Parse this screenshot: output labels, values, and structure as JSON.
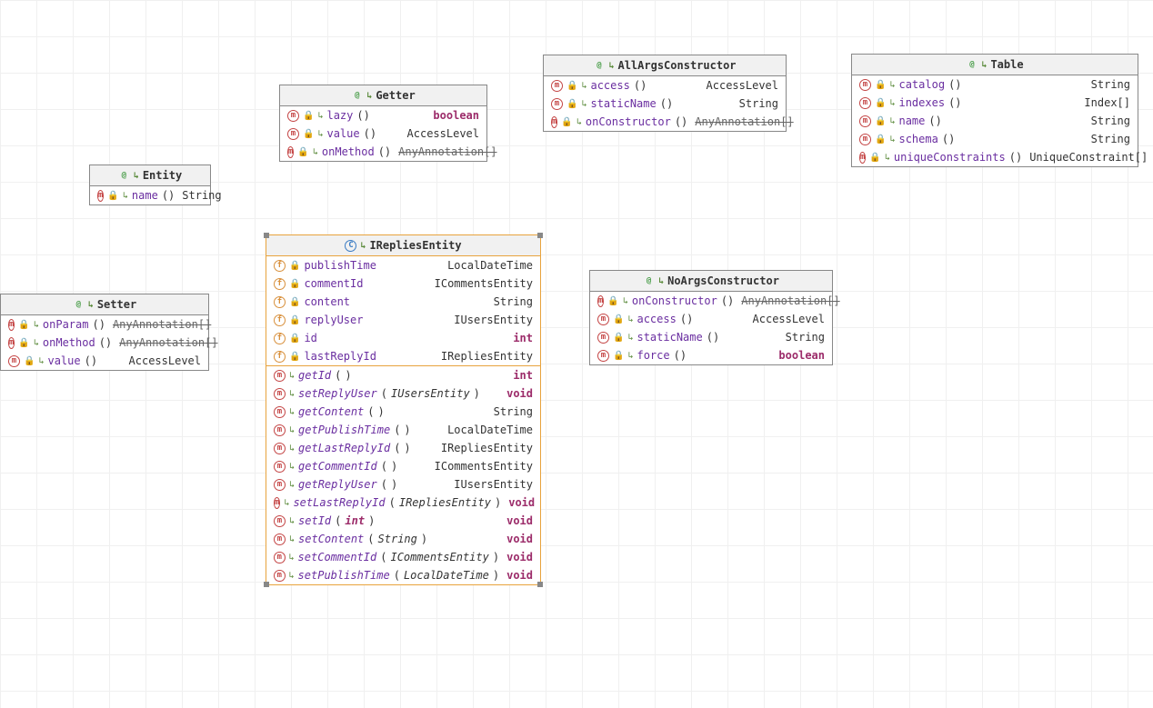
{
  "entity": {
    "title": "Entity",
    "rows": [
      {
        "icon": "m",
        "name": "name",
        "parens": "()",
        "type": "String"
      }
    ]
  },
  "getter": {
    "title": "Getter",
    "rows": [
      {
        "icon": "m",
        "name": "lazy",
        "parens": "()",
        "type": "boolean",
        "kw": true
      },
      {
        "icon": "m",
        "name": "value",
        "parens": "()",
        "type": "AccessLevel"
      },
      {
        "icon": "m",
        "name": "onMethod",
        "parens": "()",
        "type": "AnyAnnotation[]",
        "strike": true
      }
    ]
  },
  "setter": {
    "title": "Setter",
    "rows": [
      {
        "icon": "m",
        "name": "onParam",
        "parens": "()",
        "type": "AnyAnnotation[]",
        "strike": true
      },
      {
        "icon": "m",
        "name": "onMethod",
        "parens": "()",
        "type": "AnyAnnotation[]",
        "strike": true
      },
      {
        "icon": "m",
        "name": "value",
        "parens": "()",
        "type": "AccessLevel"
      }
    ]
  },
  "allargs": {
    "title": "AllArgsConstructor",
    "rows": [
      {
        "icon": "m",
        "name": "access",
        "parens": "()",
        "type": "AccessLevel"
      },
      {
        "icon": "m",
        "name": "staticName",
        "parens": "()",
        "type": "String"
      },
      {
        "icon": "m",
        "name": "onConstructor",
        "parens": "()",
        "type": "AnyAnnotation[]",
        "strike": true
      }
    ]
  },
  "noargs": {
    "title": "NoArgsConstructor",
    "rows": [
      {
        "icon": "m",
        "name": "onConstructor",
        "parens": "()",
        "type": "AnyAnnotation[]",
        "strike": true
      },
      {
        "icon": "m",
        "name": "access",
        "parens": "()",
        "type": "AccessLevel"
      },
      {
        "icon": "m",
        "name": "staticName",
        "parens": "()",
        "type": "String"
      },
      {
        "icon": "m",
        "name": "force",
        "parens": "()",
        "type": "boolean",
        "kw": true
      }
    ]
  },
  "table": {
    "title": "Table",
    "rows": [
      {
        "icon": "m",
        "name": "catalog",
        "parens": "()",
        "type": "String"
      },
      {
        "icon": "m",
        "name": "indexes",
        "parens": "()",
        "type": "Index[]"
      },
      {
        "icon": "m",
        "name": "name",
        "parens": "()",
        "type": "String"
      },
      {
        "icon": "m",
        "name": "schema",
        "parens": "()",
        "type": "String"
      },
      {
        "icon": "m",
        "name": "uniqueConstraints",
        "parens": "()",
        "type": "UniqueConstraint[]"
      }
    ]
  },
  "ireplies": {
    "title": "IRepliesEntity",
    "fields": [
      {
        "icon": "f",
        "name": "publishTime",
        "type": "LocalDateTime"
      },
      {
        "icon": "f",
        "name": "commentId",
        "type": "ICommentsEntity"
      },
      {
        "icon": "f",
        "name": "content",
        "type": "String"
      },
      {
        "icon": "f",
        "name": "replyUser",
        "type": "IUsersEntity"
      },
      {
        "icon": "f",
        "name": "id",
        "type": "int",
        "kw": true
      },
      {
        "icon": "f",
        "name": "lastReplyId",
        "type": "IRepliesEntity"
      }
    ],
    "methods": [
      {
        "icon": "m",
        "name": "getId",
        "param": "",
        "type": "int",
        "kw": true
      },
      {
        "icon": "m",
        "name": "setReplyUser",
        "param": "IUsersEntity",
        "type": "void",
        "kw": true
      },
      {
        "icon": "m",
        "name": "getContent",
        "param": "",
        "type": "String"
      },
      {
        "icon": "m",
        "name": "getPublishTime",
        "param": "",
        "type": "LocalDateTime"
      },
      {
        "icon": "m",
        "name": "getLastReplyId",
        "param": "",
        "type": "IRepliesEntity"
      },
      {
        "icon": "m",
        "name": "getCommentId",
        "param": "",
        "type": "ICommentsEntity"
      },
      {
        "icon": "m",
        "name": "getReplyUser",
        "param": "",
        "type": "IUsersEntity"
      },
      {
        "icon": "m",
        "name": "setLastReplyId",
        "param": "IRepliesEntity",
        "type": "void",
        "kw": true
      },
      {
        "icon": "m",
        "name": "setId",
        "param": "int",
        "pkw": true,
        "type": "void",
        "kw": true
      },
      {
        "icon": "m",
        "name": "setContent",
        "param": "String",
        "type": "void",
        "kw": true
      },
      {
        "icon": "m",
        "name": "setCommentId",
        "param": "ICommentsEntity",
        "type": "void",
        "kw": true
      },
      {
        "icon": "m",
        "name": "setPublishTime",
        "param": "LocalDateTime",
        "type": "void",
        "kw": true
      }
    ]
  }
}
